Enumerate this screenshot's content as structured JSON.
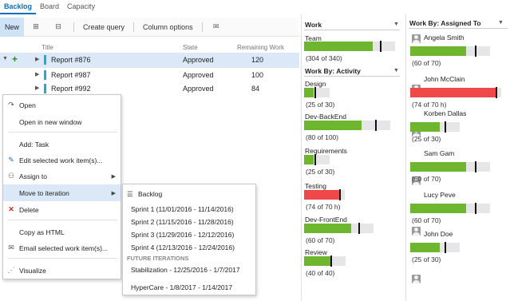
{
  "tabs": [
    "Backlog",
    "Board",
    "Capacity"
  ],
  "toolbar": {
    "new": "New",
    "create_query": "Create query",
    "column_options": "Column options"
  },
  "grid": {
    "headers": {
      "title": "Title",
      "state": "State",
      "remaining": "Remaining Work"
    },
    "rows": [
      {
        "title": "Report #876",
        "state": "Approved",
        "remaining": "120"
      },
      {
        "title": "Report #987",
        "state": "Approved",
        "remaining": "100"
      },
      {
        "title": "Report #992",
        "state": "Approved",
        "remaining": "84"
      }
    ]
  },
  "context_menu": {
    "items": [
      {
        "label": "Open",
        "icon": "open-icon"
      },
      {
        "label": "Open in new window",
        "icon": ""
      },
      {
        "label": "Add: Task",
        "icon": ""
      },
      {
        "label": "Edit selected work item(s)...",
        "icon": "pencil-icon"
      },
      {
        "label": "Assign to",
        "icon": "assign-icon"
      },
      {
        "label": "Move to iteration",
        "icon": ""
      },
      {
        "label": "Delete",
        "icon": "delete-icon"
      },
      {
        "label": "Copy as HTML",
        "icon": ""
      },
      {
        "label": "Email selected work item(s)...",
        "icon": "email-icon"
      },
      {
        "label": "Visualize",
        "icon": "visualize-icon"
      }
    ]
  },
  "iteration_submenu": {
    "backlog": "Backlog",
    "sprints": [
      "Sprint 1 (11/01/2016 - 11/14/2016)",
      "Sprint 2 (11/15/2016 - 11/28/2016)",
      "Sprint 3 (11/29/2016 - 12/12/2016)",
      "Sprint 4 (12/13/2016 - 12/24/2016)"
    ],
    "future_header": "FUTURE ITERATIONS",
    "future": [
      "Stabilization - 12/25/2016 - 1/7/2017",
      "HyperCare - 1/8/2017 - 1/14/2017"
    ]
  },
  "work": {
    "title": "Work",
    "team": {
      "label": "Team",
      "count": "(304 of 340)",
      "value": 304,
      "max": 340
    }
  },
  "work_by_activity": {
    "title": "Work By: Activity",
    "items": [
      {
        "label": "Design",
        "count": "(25 of 30)",
        "value": 25,
        "max": 30,
        "over": false
      },
      {
        "label": "Dev-BackEnd",
        "count": "(80 of 100)",
        "value": 80,
        "max": 100,
        "over": false
      },
      {
        "label": "Requirements",
        "count": "(25 of 30)",
        "value": 25,
        "max": 30,
        "over": false
      },
      {
        "label": "Testing",
        "count": "(74 of 70 h)",
        "value": 74,
        "max": 70,
        "over": true
      },
      {
        "label": "Dev-FrontEnd",
        "count": "(60 of 70)",
        "value": 60,
        "max": 70,
        "over": false
      },
      {
        "label": "Review",
        "count": "(40 of 40)",
        "value": 40,
        "max": 40,
        "over": false
      }
    ]
  },
  "work_by_assigned": {
    "title": "Work By: Assigned To",
    "items": [
      {
        "name": "Angela Smith",
        "count": "(60 of 70)",
        "value": 60,
        "max": 70,
        "over": false
      },
      {
        "name": "John McClain",
        "count": "(74 of 70 h)",
        "value": 74,
        "max": 70,
        "over": true
      },
      {
        "name": "Korben Dallas",
        "count": "(25 of 30)",
        "value": 25,
        "max": 30,
        "over": false
      },
      {
        "name": "Sam Gam",
        "count": "(60 of 70)",
        "value": 60,
        "max": 70,
        "over": false
      },
      {
        "name": "Lucy Peve",
        "count": "(60 of 70)",
        "value": 60,
        "max": 70,
        "over": false
      },
      {
        "name": "John Doe",
        "count": "(25 of 30)",
        "value": 25,
        "max": 30,
        "over": false
      }
    ]
  },
  "colors": {
    "green": "#6fb62f",
    "red": "#f04848",
    "track": "#e6e6e8",
    "accent": "#0a6fc2"
  }
}
